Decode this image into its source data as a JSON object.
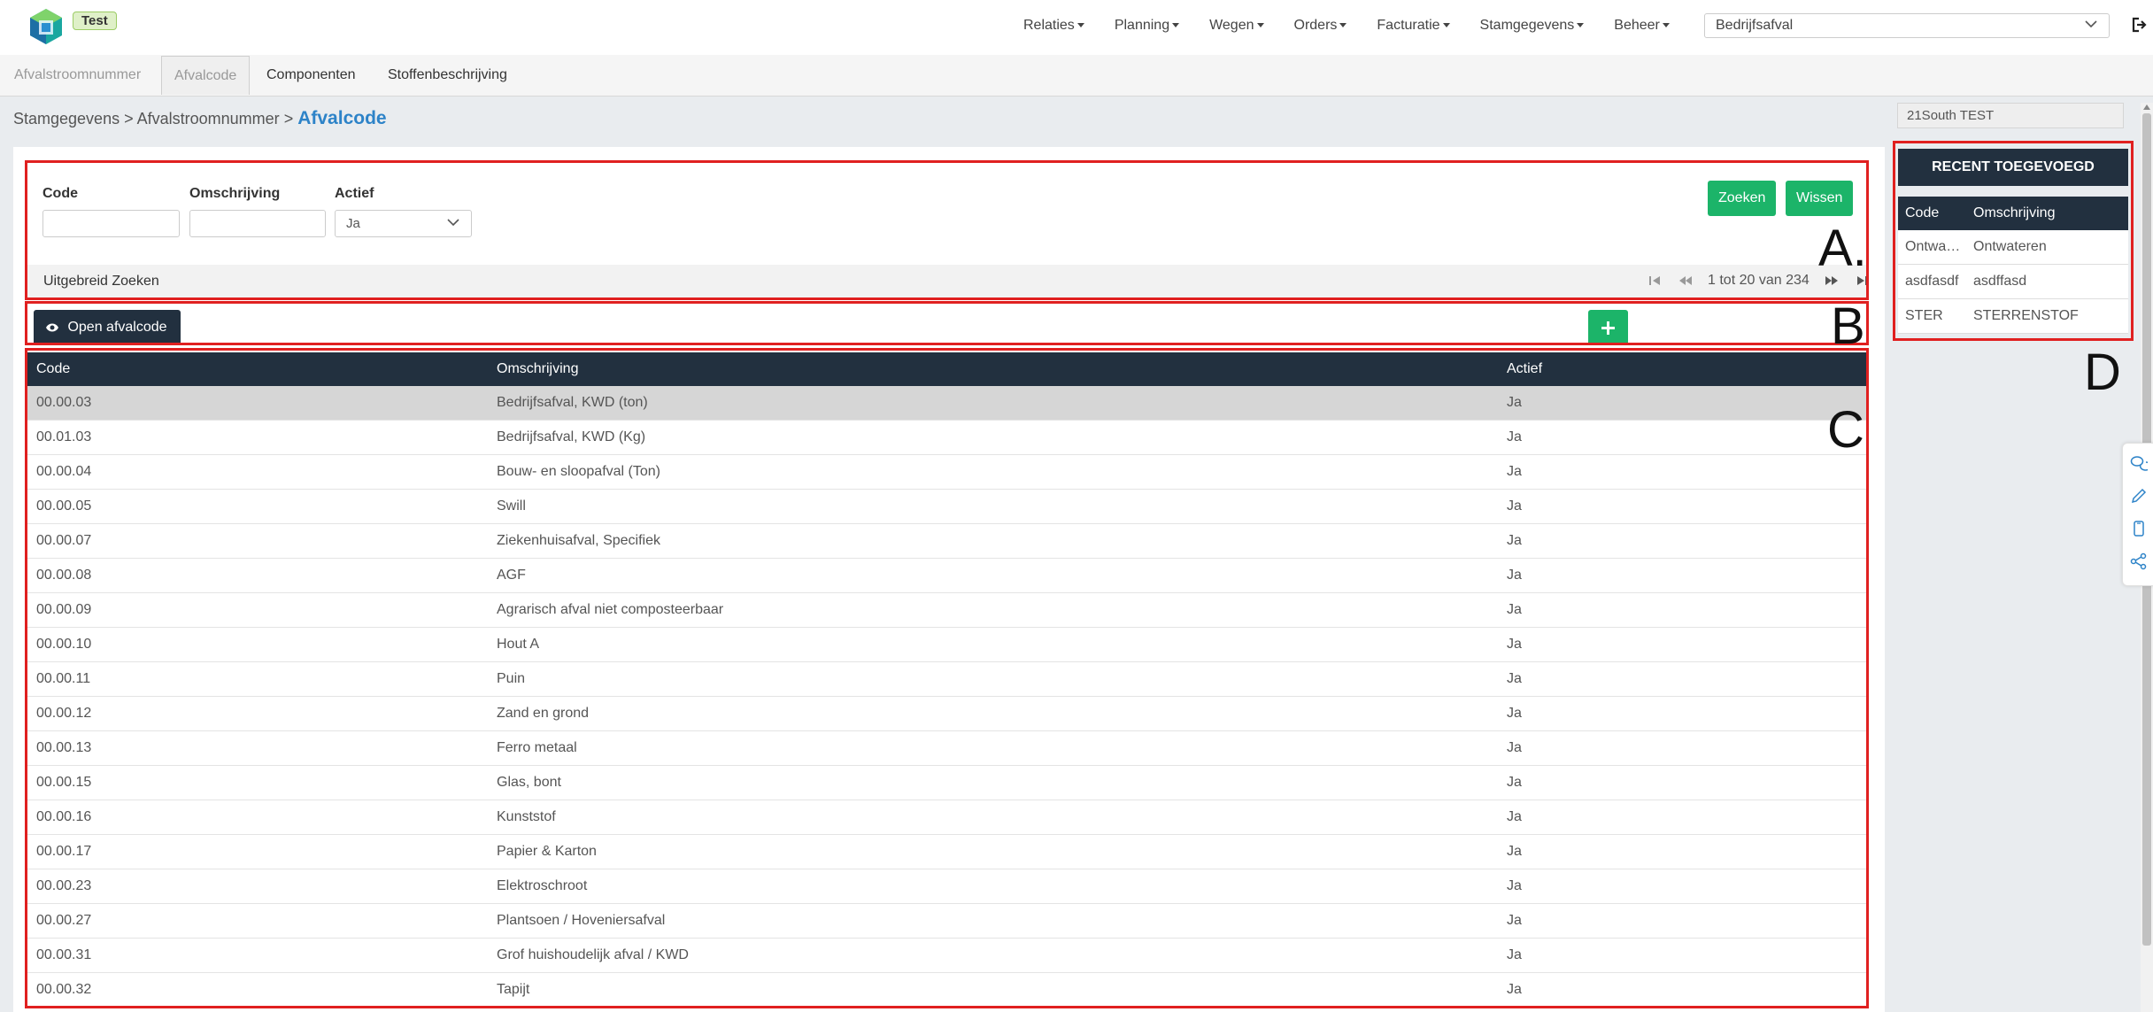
{
  "header": {
    "env_badge": "Test",
    "nav": [
      "Relaties",
      "Planning",
      "Wegen",
      "Orders",
      "Facturatie",
      "Stamgegevens",
      "Beheer"
    ],
    "afval_select": "Bedrijfsafval"
  },
  "subnav": {
    "tabs": [
      "Afvalstroomnummer",
      "Afvalcode",
      "Componenten",
      "Stoffenbeschrijving"
    ]
  },
  "breadcrumb": {
    "part1": "Stamgegevens",
    "part2": "Afvalstroomnummer",
    "sep": ">",
    "current": "Afvalcode"
  },
  "filters": {
    "code_label": "Code",
    "omschrijving_label": "Omschrijving",
    "actief_label": "Actief",
    "actief_value": "Ja",
    "search_button": "Zoeken",
    "clear_button": "Wissen",
    "extended_search": "Uitgebreid Zoeken",
    "pager_text": "1 tot 20 van 234"
  },
  "actions": {
    "open_button": "Open afvalcode"
  },
  "markers": {
    "a": "A.",
    "b": "B",
    "c": "C",
    "d": "D"
  },
  "table": {
    "headers": [
      "Code",
      "Omschrijving",
      "Actief"
    ],
    "rows": [
      {
        "code": "00.00.03",
        "omschrijving": "Bedrijfsafval, KWD (ton)",
        "actief": "Ja"
      },
      {
        "code": "00.01.03",
        "omschrijving": "Bedrijfsafval, KWD (Kg)",
        "actief": "Ja"
      },
      {
        "code": "00.00.04",
        "omschrijving": "Bouw- en sloopafval (Ton)",
        "actief": "Ja"
      },
      {
        "code": "00.00.05",
        "omschrijving": "Swill",
        "actief": "Ja"
      },
      {
        "code": "00.00.07",
        "omschrijving": "Ziekenhuisafval, Specifiek",
        "actief": "Ja"
      },
      {
        "code": "00.00.08",
        "omschrijving": "AGF",
        "actief": "Ja"
      },
      {
        "code": "00.00.09",
        "omschrijving": "Agrarisch afval niet composteerbaar",
        "actief": "Ja"
      },
      {
        "code": "00.00.10",
        "omschrijving": "Hout A",
        "actief": "Ja"
      },
      {
        "code": "00.00.11",
        "omschrijving": "Puin",
        "actief": "Ja"
      },
      {
        "code": "00.00.12",
        "omschrijving": "Zand en grond",
        "actief": "Ja"
      },
      {
        "code": "00.00.13",
        "omschrijving": "Ferro metaal",
        "actief": "Ja"
      },
      {
        "code": "00.00.15",
        "omschrijving": "Glas, bont",
        "actief": "Ja"
      },
      {
        "code": "00.00.16",
        "omschrijving": "Kunststof",
        "actief": "Ja"
      },
      {
        "code": "00.00.17",
        "omschrijving": "Papier & Karton",
        "actief": "Ja"
      },
      {
        "code": "00.00.23",
        "omschrijving": "Elektroschroot",
        "actief": "Ja"
      },
      {
        "code": "00.00.27",
        "omschrijving": "Plantsoen / Hoveniersafval",
        "actief": "Ja"
      },
      {
        "code": "00.00.31",
        "omschrijving": "Grof huishoudelijk afval / KWD",
        "actief": "Ja"
      },
      {
        "code": "00.00.32",
        "omschrijving": "Tapijt",
        "actief": "Ja"
      }
    ]
  },
  "side": {
    "tenant": "21South TEST",
    "recent_title": "RECENT TOEGEVOEGD",
    "headers": [
      "Code",
      "Omschrijving"
    ],
    "rows": [
      {
        "code": "Ontwateren",
        "omschrijving": "Ontwateren"
      },
      {
        "code": "asdfasdf",
        "omschrijving": "asdffasd"
      },
      {
        "code": "STER",
        "omschrijving": "STERRENSTOF"
      }
    ]
  },
  "icons": {
    "logo": "cube-logo-icon",
    "logout": "logout-icon",
    "tools": [
      "chat-icon",
      "pencil-icon",
      "phone-icon",
      "share-icon"
    ]
  },
  "colors": {
    "navy": "#22303f",
    "green": "#1cb469",
    "link_blue": "#2d83c8",
    "annotation_red": "#e02020"
  }
}
